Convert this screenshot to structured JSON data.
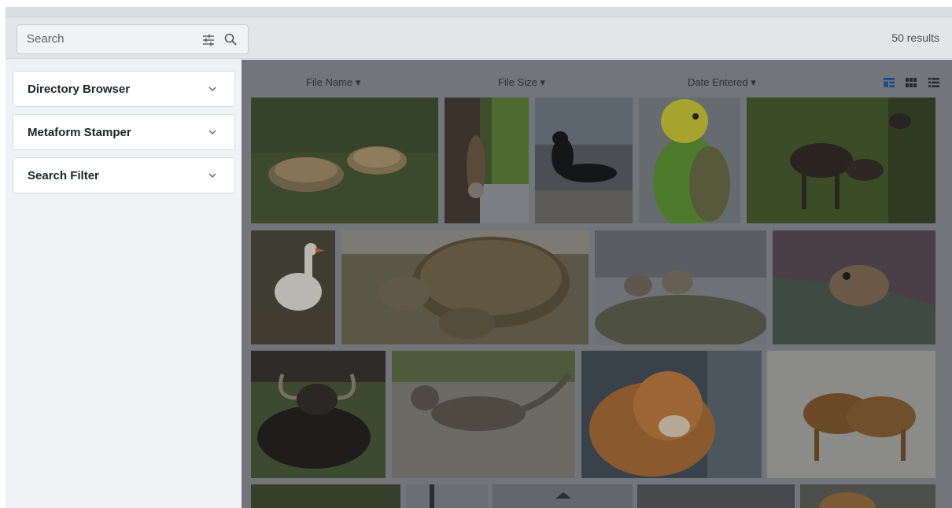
{
  "search": {
    "placeholder": "Search"
  },
  "results": {
    "count_text": "50 results"
  },
  "sidebar": {
    "panels": [
      {
        "label": "Directory Browser"
      },
      {
        "label": "Metaform Stamper"
      },
      {
        "label": "Search Filter"
      }
    ]
  },
  "sort": {
    "file_name": "File Name ▾",
    "file_size": "File Size ▾",
    "date_entered": "Date Entered ▾"
  },
  "view_modes": [
    "masonry-view-icon",
    "grid-view-icon",
    "list-view-icon"
  ],
  "colors": {
    "accent": "#1f6fd6",
    "overlay": "#72757a"
  },
  "images": [
    {
      "subject": "tortoises"
    },
    {
      "subject": "squirrel"
    },
    {
      "subject": "black-cat"
    },
    {
      "subject": "parakeet"
    },
    {
      "subject": "moose"
    },
    {
      "subject": "goose"
    },
    {
      "subject": "tortoise"
    },
    {
      "subject": "wolves"
    },
    {
      "subject": "dog-under-blanket"
    },
    {
      "subject": "yak"
    },
    {
      "subject": "tabby-cat"
    },
    {
      "subject": "tiger"
    },
    {
      "subject": "tigers"
    },
    {
      "subject": "forest"
    },
    {
      "subject": "structure"
    },
    {
      "subject": "lines"
    },
    {
      "subject": "dark-scene"
    },
    {
      "subject": "orange-animal"
    }
  ]
}
